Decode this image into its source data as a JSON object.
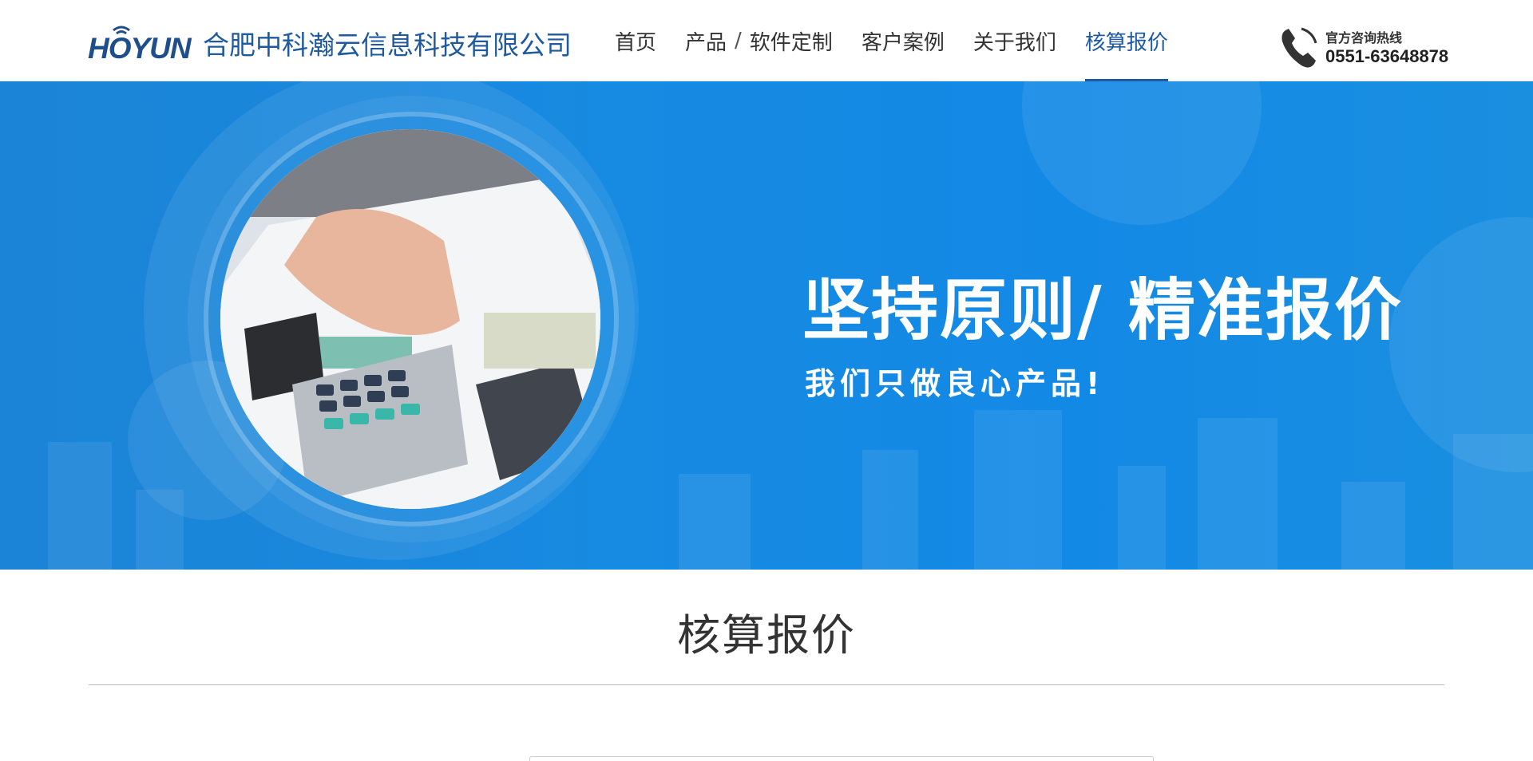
{
  "header": {
    "logo_text": "HOYUN",
    "company_name": "合肥中科瀚云信息科技有限公司",
    "nav": [
      {
        "label": "首页",
        "active": false
      },
      {
        "label": "产品",
        "sep": "/",
        "label2": "软件定制",
        "active": false
      },
      {
        "label": "客户案例",
        "active": false
      },
      {
        "label": "关于我们",
        "active": false
      },
      {
        "label": "核算报价",
        "active": true
      }
    ],
    "hotline_label": "官方咨询热线",
    "hotline_number": "0551-63648878"
  },
  "banner": {
    "title": "坚持原则/ 精准报价",
    "subtitle": "我们只做良心产品!"
  },
  "content": {
    "page_title": "核算报价"
  },
  "colors": {
    "brand": "#1e5aa6",
    "banner_blue": "#178ae1"
  },
  "icons": {
    "phone": "phone-icon",
    "wifi": "wifi-logo-icon"
  }
}
